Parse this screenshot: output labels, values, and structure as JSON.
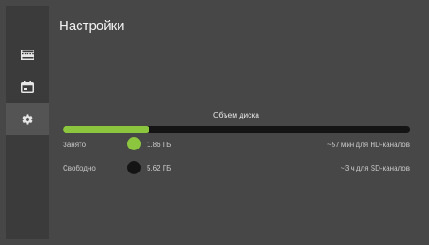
{
  "settings": {
    "title": "Настройки"
  },
  "sidebar": {
    "items": [
      {
        "icon": "film-strip-icon",
        "active": false
      },
      {
        "icon": "tv-guide-icon",
        "active": false
      },
      {
        "icon": "gear-icon",
        "active": true
      }
    ]
  },
  "disk": {
    "label": "Объем диска",
    "used_fraction": 0.25,
    "used": {
      "label": "Занято",
      "size": "1.86 ГБ",
      "estimate": "~57 мин для HD-каналов",
      "color": "#8cc63f"
    },
    "free": {
      "label": "Свободно",
      "size": "5.62 ГБ",
      "estimate": "~3 ч для SD-каналов",
      "color": "#141414"
    }
  }
}
